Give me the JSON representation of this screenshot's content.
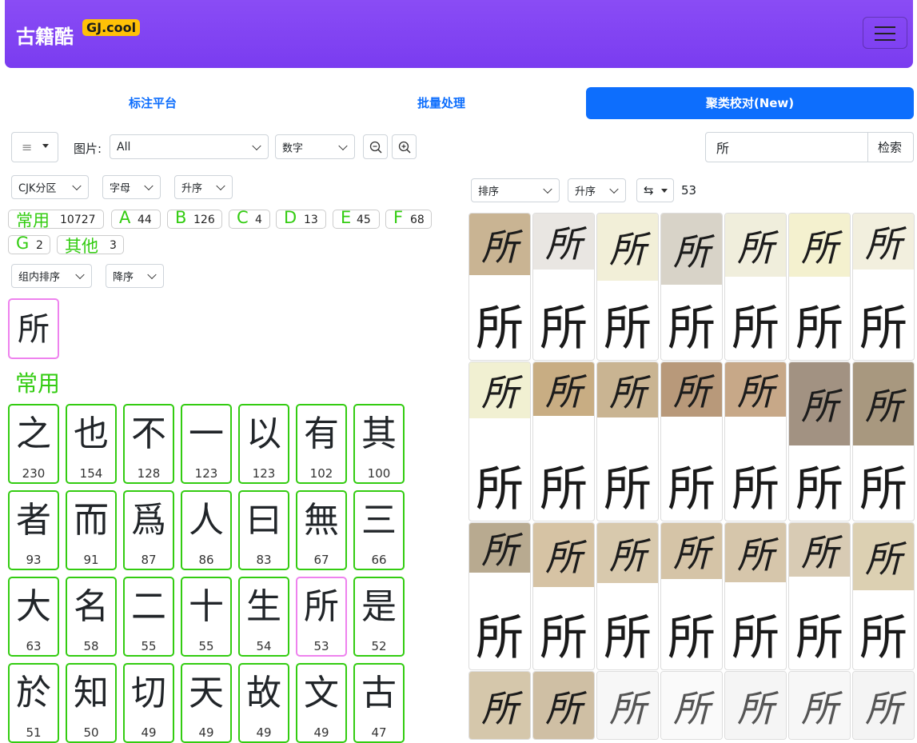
{
  "app": {
    "brand": "古籍酷",
    "badge": "GJ.cool"
  },
  "tabs": [
    {
      "label": "标注平台",
      "active": false
    },
    {
      "label": "批量处理",
      "active": false
    },
    {
      "label": "聚类校对(New)",
      "active": true
    }
  ],
  "toolbar": {
    "menu_icon": "≡",
    "image_label": "图片:",
    "image_value": "All",
    "mode_value": "数字",
    "zoom_out_icon": "zoom-out",
    "zoom_in_icon": "zoom-in",
    "search_value": "所",
    "search_button": "检索"
  },
  "filters": {
    "cjk": "CJK分区",
    "letter": "字母",
    "order": "升序"
  },
  "letters": [
    {
      "label": "常用",
      "count": "10727"
    },
    {
      "label": "A",
      "count": "44"
    },
    {
      "label": "B",
      "count": "126"
    },
    {
      "label": "C",
      "count": "4"
    },
    {
      "label": "D",
      "count": "13"
    },
    {
      "label": "E",
      "count": "45"
    },
    {
      "label": "F",
      "count": "68"
    },
    {
      "label": "G",
      "count": "2"
    },
    {
      "label": "其他",
      "count": "3"
    }
  ],
  "group_sort": {
    "label": "组内排序",
    "order": "降序"
  },
  "selected_char": "所",
  "section_title": "常用",
  "chars": [
    {
      "ch": "之",
      "n": "230"
    },
    {
      "ch": "也",
      "n": "154"
    },
    {
      "ch": "不",
      "n": "128"
    },
    {
      "ch": "一",
      "n": "123"
    },
    {
      "ch": "以",
      "n": "123"
    },
    {
      "ch": "有",
      "n": "102"
    },
    {
      "ch": "其",
      "n": "100"
    },
    {
      "ch": "者",
      "n": "93"
    },
    {
      "ch": "而",
      "n": "91"
    },
    {
      "ch": "爲",
      "n": "87"
    },
    {
      "ch": "人",
      "n": "86"
    },
    {
      "ch": "曰",
      "n": "83"
    },
    {
      "ch": "無",
      "n": "67"
    },
    {
      "ch": "三",
      "n": "66"
    },
    {
      "ch": "大",
      "n": "63"
    },
    {
      "ch": "名",
      "n": "58"
    },
    {
      "ch": "二",
      "n": "55"
    },
    {
      "ch": "十",
      "n": "55"
    },
    {
      "ch": "生",
      "n": "54"
    },
    {
      "ch": "所",
      "n": "53"
    },
    {
      "ch": "是",
      "n": "52"
    },
    {
      "ch": "於",
      "n": "51"
    },
    {
      "ch": "知",
      "n": "50"
    },
    {
      "ch": "切",
      "n": "49"
    },
    {
      "ch": "天",
      "n": "49"
    },
    {
      "ch": "故",
      "n": "49"
    },
    {
      "ch": "文",
      "n": "49"
    },
    {
      "ch": "古",
      "n": "47"
    }
  ],
  "highlighted_char": "所",
  "right_panel": {
    "sort": "排序",
    "order": "升序",
    "swap_icon": "⇆",
    "count": "53",
    "cell_glyph": "所",
    "scan_colors": [
      "#c9b493",
      "#e9e6e2",
      "#f2efd8",
      "#d8d3c8",
      "#f0eedc",
      "#f4f1cf",
      "#f2efde",
      "#f1f0d2",
      "#c8ad83",
      "#c9b492",
      "#b8997a",
      "#c7a888",
      "#a29282",
      "#a8987f",
      "#b8aa90",
      "#d6c3a4",
      "#d8c9ad",
      "#d5c4a7",
      "#d6c6ab",
      "#d8cbb4",
      "#dcd0b2",
      "#d5c7ab",
      "#cfbfa4",
      "#f7f7f7",
      "#fafafa",
      "#f5f5f5",
      "#f7f7f7",
      "#f4f4f4"
    ]
  }
}
